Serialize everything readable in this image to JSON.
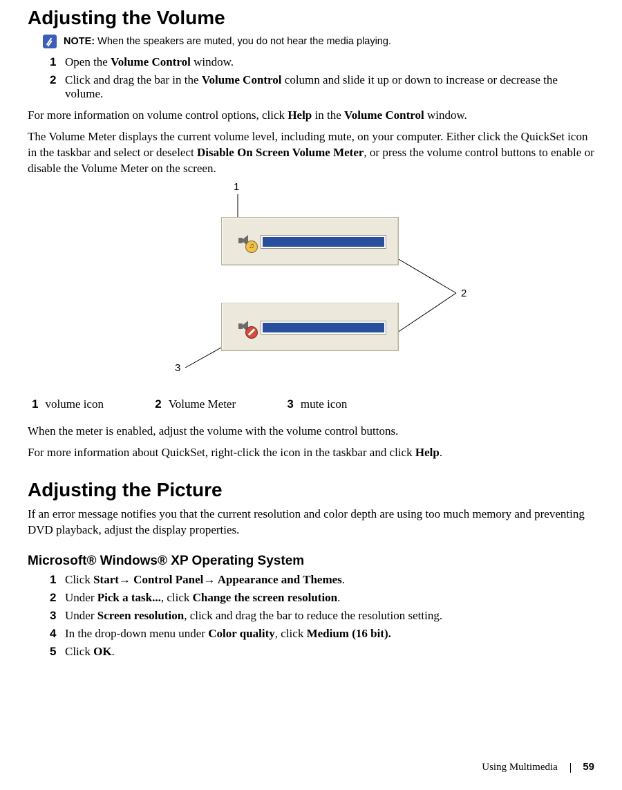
{
  "heading1": "Adjusting the Volume",
  "note": {
    "prefix": "NOTE:",
    "text": " When the speakers are muted, you do not hear the media playing."
  },
  "steps1": [
    {
      "n": "1",
      "pre": "Open the ",
      "bold": "Volume Control",
      "post": " window."
    },
    {
      "n": "2",
      "pre": "Click and drag the bar in the ",
      "bold": "Volume Control",
      "post": " column and slide it up or down to increase or decrease the volume."
    }
  ],
  "para1": {
    "pre": "For more information on volume control options, click ",
    "bold1": "Help",
    "mid": " in the ",
    "bold2": "Volume Control",
    "post": " window."
  },
  "para2": {
    "pre": "The Volume Meter displays the current volume level, including mute, on your computer. Either click the QuickSet icon in the taskbar and select or deselect ",
    "bold1": "Disable On Screen Volume Meter",
    "post": ", or press the volume control buttons to enable or disable the Volume Meter on the screen."
  },
  "callouts": {
    "c1": "1",
    "c2": "2",
    "c3": "3"
  },
  "legend": [
    {
      "n": "1",
      "t": "volume icon"
    },
    {
      "n": "2",
      "t": "Volume Meter"
    },
    {
      "n": "3",
      "t": "mute icon"
    }
  ],
  "para3": "When the meter is enabled, adjust the volume with the volume control buttons.",
  "para4": {
    "pre": "For more information about QuickSet, right-click the icon in the taskbar and click ",
    "bold1": "Help",
    "post": "."
  },
  "heading2": "Adjusting the Picture",
  "para5": "If an error message notifies you that the current resolution and color depth are using too much memory and preventing DVD playback, adjust the display properties.",
  "heading3": "Microsoft® Windows® XP Operating System",
  "arrow": "→",
  "steps2": [
    {
      "n": "1",
      "type": "nav",
      "pre": "Click ",
      "b1": "Start",
      "b2": " Control Panel",
      "b3": " Appearance and Themes",
      "post": "."
    },
    {
      "n": "2",
      "type": "twobold",
      "pre": "Under ",
      "b1": "Pick a task...",
      "mid": ", click ",
      "b2": "Change the screen resolution",
      "post": "."
    },
    {
      "n": "3",
      "type": "onebold",
      "pre": "Under ",
      "b1": "Screen resolution",
      "post": ", click and drag the bar to reduce the resolution setting."
    },
    {
      "n": "4",
      "type": "twobold",
      "pre": "In the drop-down menu under ",
      "b1": "Color quality",
      "mid": ", click ",
      "b2": "Medium (16 bit).",
      "post": ""
    },
    {
      "n": "5",
      "type": "onebold",
      "pre": "Click ",
      "b1": "OK",
      "post": "."
    }
  ],
  "footer": {
    "section": "Using Multimedia",
    "page": "59"
  }
}
